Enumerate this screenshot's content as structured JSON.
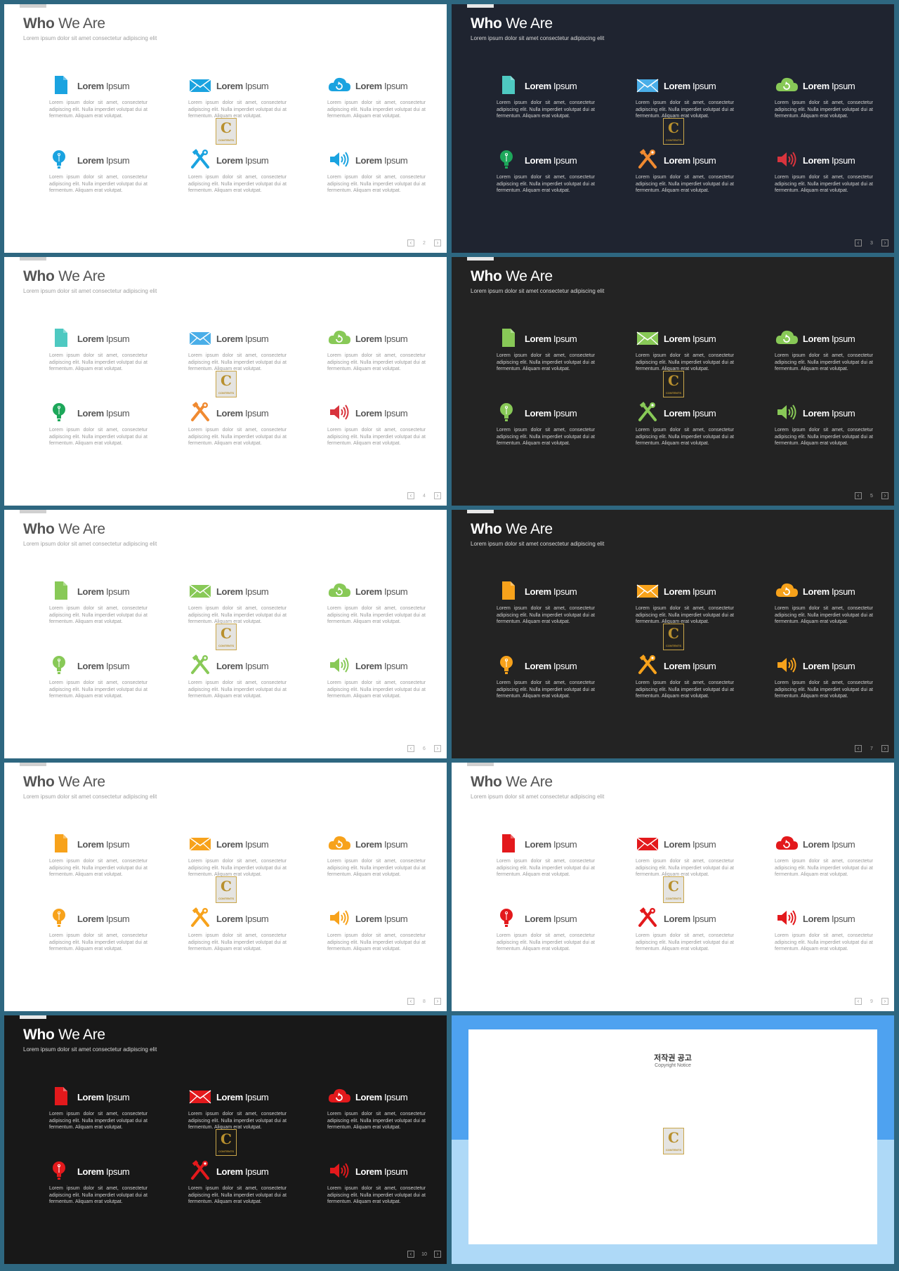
{
  "colors": {
    "page_background": "#2e6780",
    "white_slide": "#ffffff",
    "navy_slide": "#1f2430",
    "charcoal_slide": "#232323",
    "black_slide": "#181818",
    "blue": "#1aa3e0",
    "teal": "#4ec9c1",
    "sky": "#4aaee8",
    "lime": "#88c957",
    "green": "#1da75a",
    "orange": "#f08a30",
    "amber": "#f7a21b",
    "red": "#e3191c",
    "crimson": "#d8343d",
    "watermark_gold": "#b8902e"
  },
  "slide_template": {
    "title_bold": "Who",
    "title_rest": " We Are",
    "subtitle": "Lorem ipsum dolor sit amet consectetur adipiscing elit",
    "feature_label_bold": "Lorem",
    "feature_label_rest": " Ipsum",
    "feature_desc": "Lorem ipsum dolor sit amet, consectetur adipiscing elit. Nulla imperdiet volutpat dui at fermentum. Aliquam erat volutpat.",
    "pager_prev": "‹",
    "pager_next": "›",
    "watermark_letter": "C",
    "watermark_text": "CONTENTS"
  },
  "features": [
    {
      "icon": "document-icon"
    },
    {
      "icon": "envelope-icon"
    },
    {
      "icon": "cloud-refresh-icon"
    },
    {
      "icon": "lightbulb-icon"
    },
    {
      "icon": "tools-icon"
    },
    {
      "icon": "speaker-icon"
    }
  ],
  "slides": [
    {
      "page": "2",
      "theme": "light",
      "bg": "#ffffff",
      "icon_colors": [
        "#1aa3e0",
        "#1aa3e0",
        "#1aa3e0",
        "#1aa3e0",
        "#1aa3e0",
        "#1aa3e0"
      ]
    },
    {
      "page": "3",
      "theme": "dark",
      "bg": "#1f2430",
      "icon_colors": [
        "#4ec9c1",
        "#4aaee8",
        "#88c957",
        "#1da75a",
        "#f08a30",
        "#d8343d"
      ]
    },
    {
      "page": "4",
      "theme": "light",
      "bg": "#ffffff",
      "icon_colors": [
        "#4ec9c1",
        "#4aaee8",
        "#88c957",
        "#1da75a",
        "#f08a30",
        "#d8343d"
      ]
    },
    {
      "page": "5",
      "theme": "dark",
      "bg": "#232323",
      "icon_colors": [
        "#88c957",
        "#88c957",
        "#88c957",
        "#88c957",
        "#88c957",
        "#88c957"
      ]
    },
    {
      "page": "6",
      "theme": "light",
      "bg": "#ffffff",
      "icon_colors": [
        "#88c957",
        "#88c957",
        "#88c957",
        "#88c957",
        "#88c957",
        "#88c957"
      ]
    },
    {
      "page": "7",
      "theme": "dark",
      "bg": "#232323",
      "icon_colors": [
        "#f7a21b",
        "#f7a21b",
        "#f7a21b",
        "#f7a21b",
        "#f7a21b",
        "#f7a21b"
      ]
    },
    {
      "page": "8",
      "theme": "light",
      "bg": "#ffffff",
      "icon_colors": [
        "#f7a21b",
        "#f7a21b",
        "#f7a21b",
        "#f7a21b",
        "#f7a21b",
        "#f7a21b"
      ]
    },
    {
      "page": "9",
      "theme": "light",
      "bg": "#ffffff",
      "icon_colors": [
        "#e3191c",
        "#e3191c",
        "#e3191c",
        "#e3191c",
        "#e3191c",
        "#e3191c"
      ]
    },
    {
      "page": "10",
      "theme": "dark",
      "bg": "#181818",
      "icon_colors": [
        "#e3191c",
        "#e3191c",
        "#e3191c",
        "#e3191c",
        "#e3191c",
        "#e3191c"
      ]
    }
  ],
  "copyright": {
    "title": "저작권 공고",
    "subtitle": "Copyright Notice",
    "paragraphs": [
      "",
      "",
      "",
      "",
      ""
    ]
  }
}
